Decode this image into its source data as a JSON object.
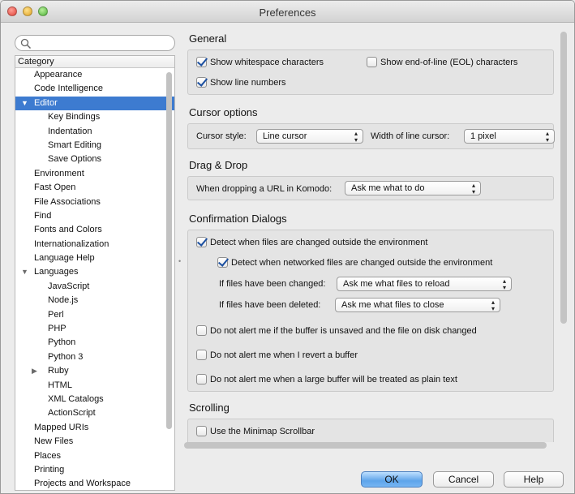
{
  "window": {
    "title": "Preferences"
  },
  "search": {
    "placeholder": ""
  },
  "category": {
    "header": "Category",
    "items": [
      {
        "label": "Appearance",
        "level": 0
      },
      {
        "label": "Code Intelligence",
        "level": 0
      },
      {
        "label": "Editor",
        "level": 0,
        "expanded": true,
        "selected": true
      },
      {
        "label": "Key Bindings",
        "level": 1
      },
      {
        "label": "Indentation",
        "level": 1
      },
      {
        "label": "Smart Editing",
        "level": 1
      },
      {
        "label": "Save Options",
        "level": 1
      },
      {
        "label": "Environment",
        "level": 0
      },
      {
        "label": "Fast Open",
        "level": 0
      },
      {
        "label": "File Associations",
        "level": 0
      },
      {
        "label": "Find",
        "level": 0
      },
      {
        "label": "Fonts and Colors",
        "level": 0
      },
      {
        "label": "Internationalization",
        "level": 0
      },
      {
        "label": "Language Help",
        "level": 0
      },
      {
        "label": "Languages",
        "level": 0,
        "expanded": true
      },
      {
        "label": "JavaScript",
        "level": 1
      },
      {
        "label": "Node.js",
        "level": 1
      },
      {
        "label": "Perl",
        "level": 1
      },
      {
        "label": "PHP",
        "level": 1
      },
      {
        "label": "Python",
        "level": 1
      },
      {
        "label": "Python 3",
        "level": 1
      },
      {
        "label": "Ruby",
        "level": 1,
        "collapsed": true
      },
      {
        "label": "HTML",
        "level": 1
      },
      {
        "label": "XML Catalogs",
        "level": 1
      },
      {
        "label": "ActionScript",
        "level": 1
      },
      {
        "label": "Mapped URIs",
        "level": 0
      },
      {
        "label": "New Files",
        "level": 0
      },
      {
        "label": "Places",
        "level": 0
      },
      {
        "label": "Printing",
        "level": 0
      },
      {
        "label": "Projects and Workspace",
        "level": 0
      }
    ]
  },
  "general": {
    "title": "General",
    "show_whitespace": {
      "label": "Show whitespace characters",
      "checked": true
    },
    "show_eol": {
      "label": "Show end-of-line (EOL) characters",
      "checked": false
    },
    "show_line_numbers": {
      "label": "Show line numbers",
      "checked": true
    }
  },
  "cursor": {
    "title": "Cursor options",
    "style_label": "Cursor style:",
    "style_value": "Line cursor",
    "width_label": "Width of line cursor:",
    "width_value": "1 pixel"
  },
  "dragdrop": {
    "title": "Drag & Drop",
    "url_label": "When dropping a URL in Komodo:",
    "url_value": "Ask me what to do"
  },
  "confirm": {
    "title": "Confirmation Dialogs",
    "detect_changed": {
      "label": "Detect when files are changed outside the environment",
      "checked": true
    },
    "detect_networked": {
      "label": "Detect when networked files are changed outside the environment",
      "checked": true
    },
    "changed_label": "If files have been changed:",
    "changed_value": "Ask me what files to reload",
    "deleted_label": "If files have been deleted:",
    "deleted_value": "Ask me what files to close",
    "no_alert_unsaved": {
      "label": "Do not alert me if the buffer is unsaved and the file on disk changed",
      "checked": false
    },
    "no_alert_revert": {
      "label": "Do not alert me when I revert a buffer",
      "checked": false
    },
    "no_alert_large": {
      "label": "Do not alert me when a large buffer will be treated as plain text",
      "checked": false
    }
  },
  "scrolling": {
    "title": "Scrolling",
    "minimap": {
      "label": "Use the Minimap Scrollbar",
      "checked": false
    }
  },
  "buttons": {
    "ok": "OK",
    "cancel": "Cancel",
    "help": "Help"
  },
  "colors": {
    "selection": "#3d7bd0",
    "default_button": "#5ea4ea"
  }
}
